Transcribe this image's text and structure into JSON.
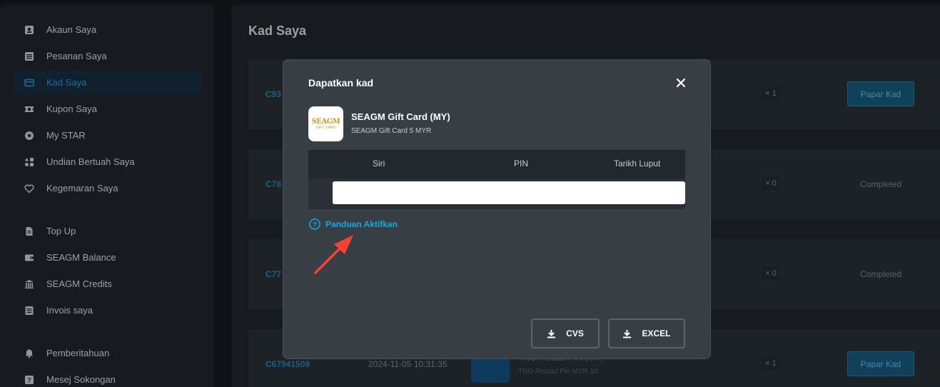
{
  "sidebar": {
    "items": [
      {
        "label": "Akaun Saya",
        "icon": "account-icon"
      },
      {
        "label": "Pesanan Saya",
        "icon": "orders-icon"
      },
      {
        "label": "Kad Saya",
        "icon": "card-icon",
        "active": true
      },
      {
        "label": "Kupon Saya",
        "icon": "ticket-icon"
      },
      {
        "label": "My STAR",
        "icon": "star-icon"
      },
      {
        "label": "Undian Bertuah Saya",
        "icon": "shapes-icon"
      },
      {
        "label": "Kegemaran Saya",
        "icon": "heart-icon"
      },
      {
        "label": "Top Up",
        "icon": "document-icon"
      },
      {
        "label": "SEAGM Balance",
        "icon": "wallet-icon"
      },
      {
        "label": "SEAGM Credits",
        "icon": "bank-icon"
      },
      {
        "label": "Invois saya",
        "icon": "invoice-icon"
      },
      {
        "label": "Pemberitahuan",
        "icon": "bell-icon"
      },
      {
        "label": "Mesej Sokongan",
        "icon": "help-icon"
      }
    ]
  },
  "main": {
    "title": "Kad Saya",
    "orders": [
      {
        "code": "C93",
        "qty": "× 1",
        "action": "Papar Kad"
      },
      {
        "code": "C78",
        "qty": "× 0",
        "status": "Completed"
      },
      {
        "code": "C77",
        "qty": "× 0",
        "status": "Completed"
      },
      {
        "code": "C67941509",
        "date": "2024-11-05 10:31:35",
        "product": "TNG Reload PIN (MY)",
        "product_sub": "TNG Reload Pin MYR 10",
        "qty": "× 1",
        "action": "Papar Kad"
      }
    ]
  },
  "modal": {
    "title": "Dapatkan kad",
    "card_name": "SEAGM Gift Card (MY)",
    "card_sub": "SEAGM Gift Card 5 MYR",
    "logo_main": "SEAGM",
    "logo_sub": "GIFT CARD",
    "table": {
      "columns": [
        "Siri",
        "PIN",
        "Tarikh Luput"
      ]
    },
    "guide_label": "Panduan Aktifkan",
    "buttons": {
      "cvs": "CVS",
      "excel": "EXCEL"
    }
  },
  "colors": {
    "accent": "#17a7e6",
    "modal_bg": "#373e44",
    "annotation_arrow": "#f44336"
  }
}
